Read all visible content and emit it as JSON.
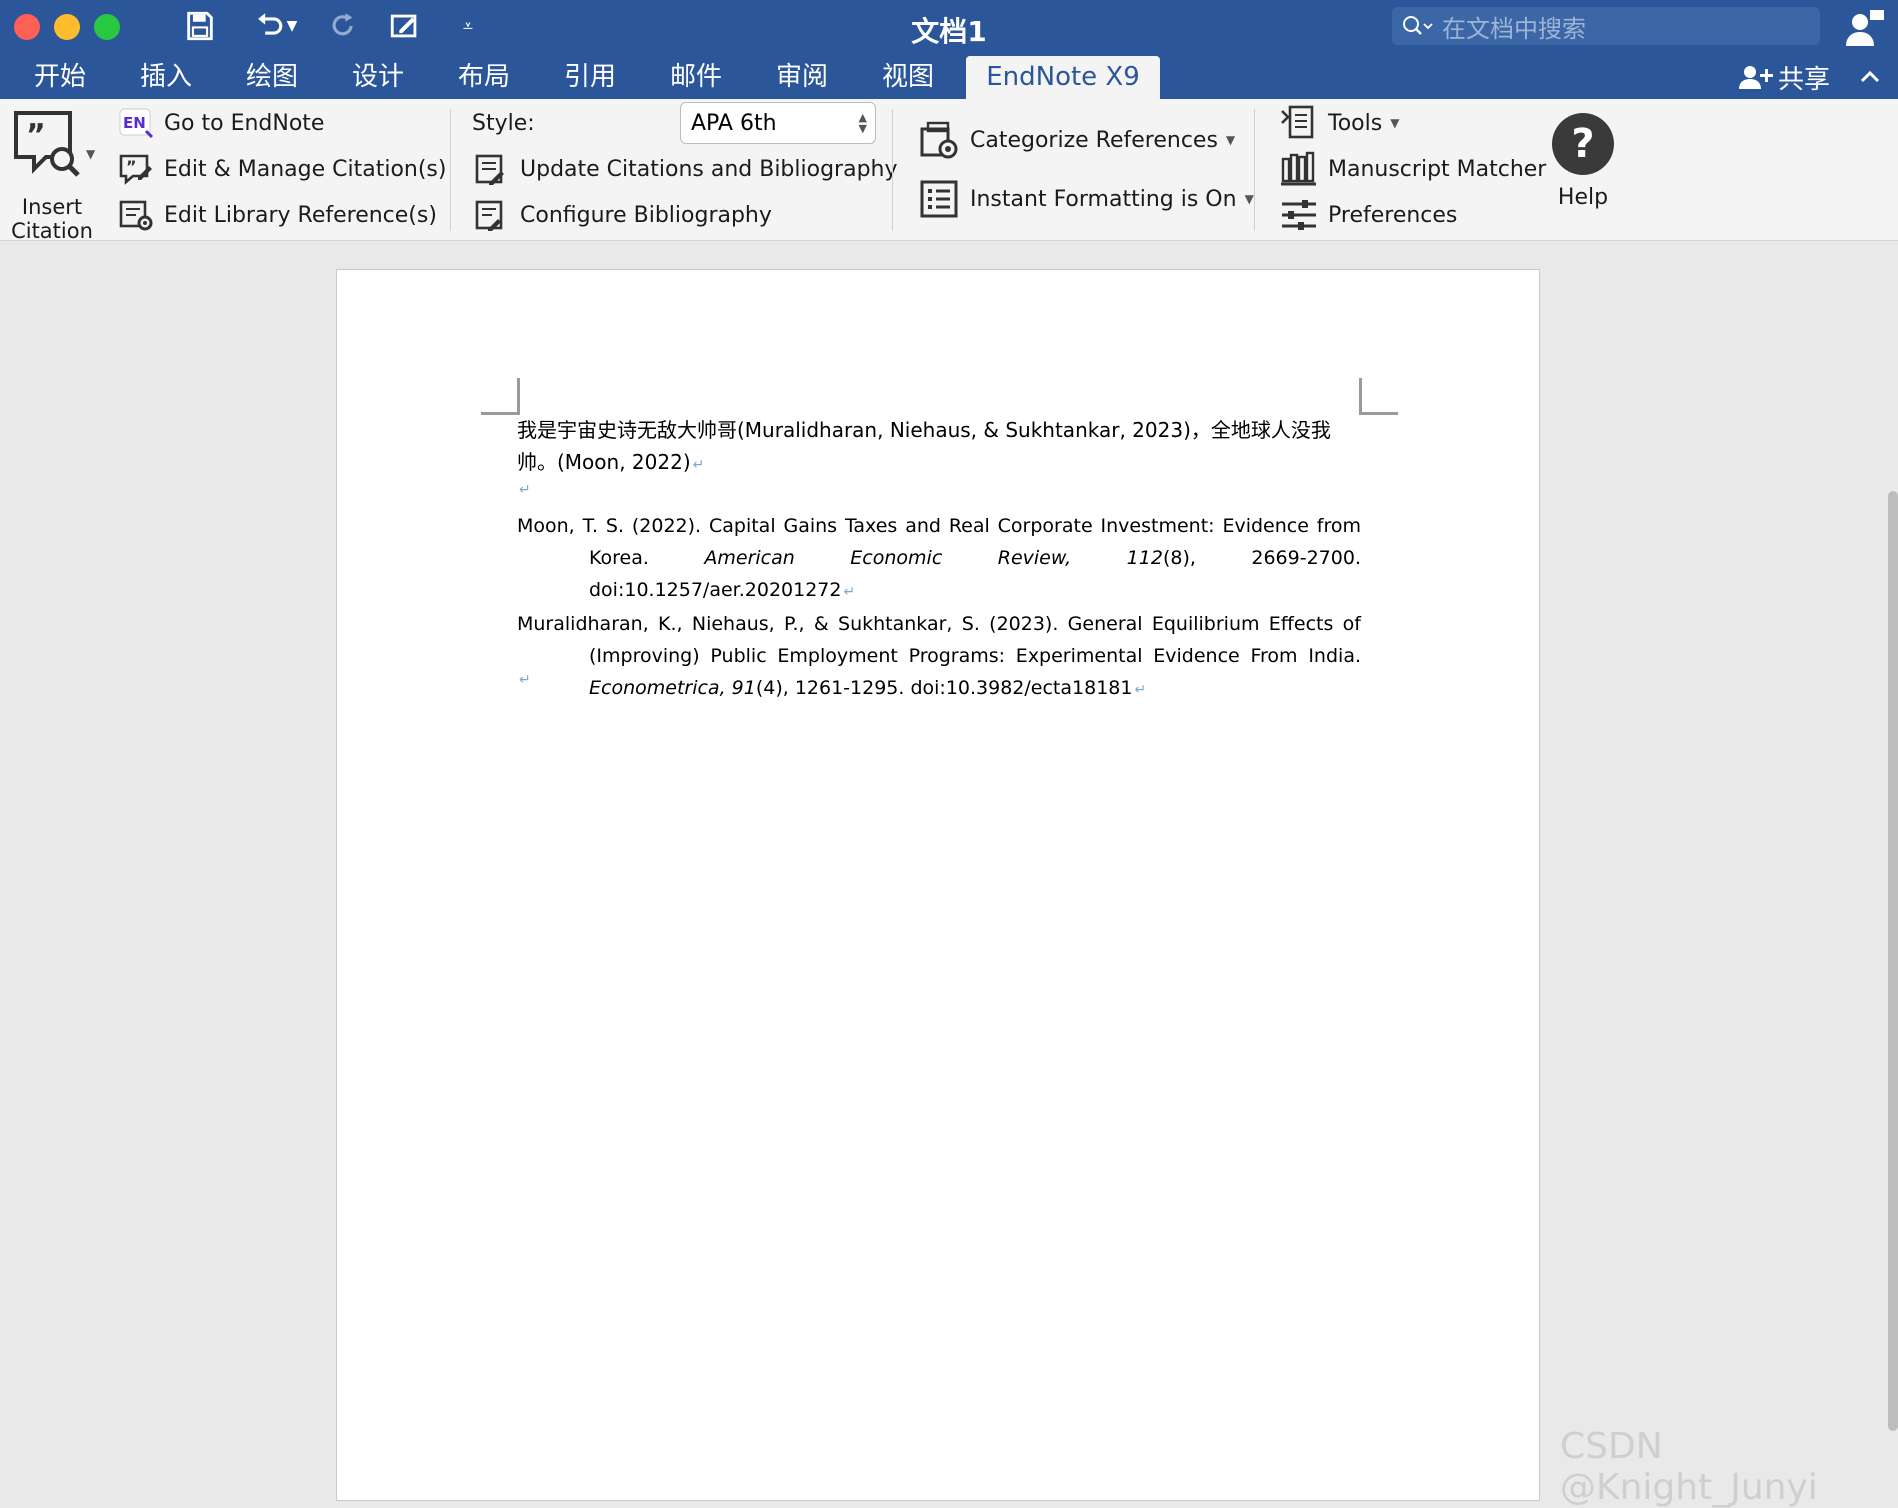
{
  "window": {
    "title": "文档1"
  },
  "search": {
    "placeholder": "在文档中搜索"
  },
  "tabs": [
    {
      "label": "开始"
    },
    {
      "label": "插入"
    },
    {
      "label": "绘图"
    },
    {
      "label": "设计"
    },
    {
      "label": "布局"
    },
    {
      "label": "引用"
    },
    {
      "label": "邮件"
    },
    {
      "label": "审阅"
    },
    {
      "label": "视图"
    },
    {
      "label": "EndNote X9",
      "active": true
    }
  ],
  "share": {
    "label": "共享"
  },
  "ribbon": {
    "insert_citation": {
      "line1": "Insert",
      "line2": "Citation"
    },
    "go_to_endnote": "Go to EndNote",
    "edit_manage": "Edit & Manage Citation(s)",
    "edit_library": "Edit Library Reference(s)",
    "style_label": "Style:",
    "style_value": "APA 6th",
    "update_citations": "Update Citations and Bibliography",
    "configure_bibliography": "Configure Bibliography",
    "categorize": "Categorize References",
    "instant_formatting": "Instant Formatting is On",
    "tools": "Tools",
    "manuscript_matcher": "Manuscript Matcher",
    "preferences": "Preferences",
    "help": "Help"
  },
  "document": {
    "paragraph": "我是宇宙史诗无敌大帅哥(Muralidharan, Niehaus, & Sukhtankar, 2023)，全地球人没我帅。(Moon, 2022)",
    "ref1": {
      "pre": "Moon, T. S. (2022). Capital Gains Taxes and Real Corporate Investment: Evidence from Korea. ",
      "journal": "American Economic Review, 112",
      "post": "(8), 2669-2700. doi:10.1257/aer.20201272"
    },
    "ref2": {
      "pre": "Muralidharan, K., Niehaus, P., & Sukhtankar, S. (2023). General Equilibrium Effects of (Improving) Public Employment Programs: Experimental Evidence From India. ",
      "journal": "Econometrica, 91",
      "post": "(4), 1261-1295. doi:10.3982/ecta18181"
    },
    "pilcrow": "↵"
  },
  "watermark": "CSDN @Knight_Junyi",
  "colors": {
    "titlebar": "#2b579a",
    "ribbon": "#f4f4f4",
    "canvas": "#e9e9e9",
    "close": "#fe5f57",
    "minimize": "#febc2e",
    "maximize": "#28c840"
  }
}
